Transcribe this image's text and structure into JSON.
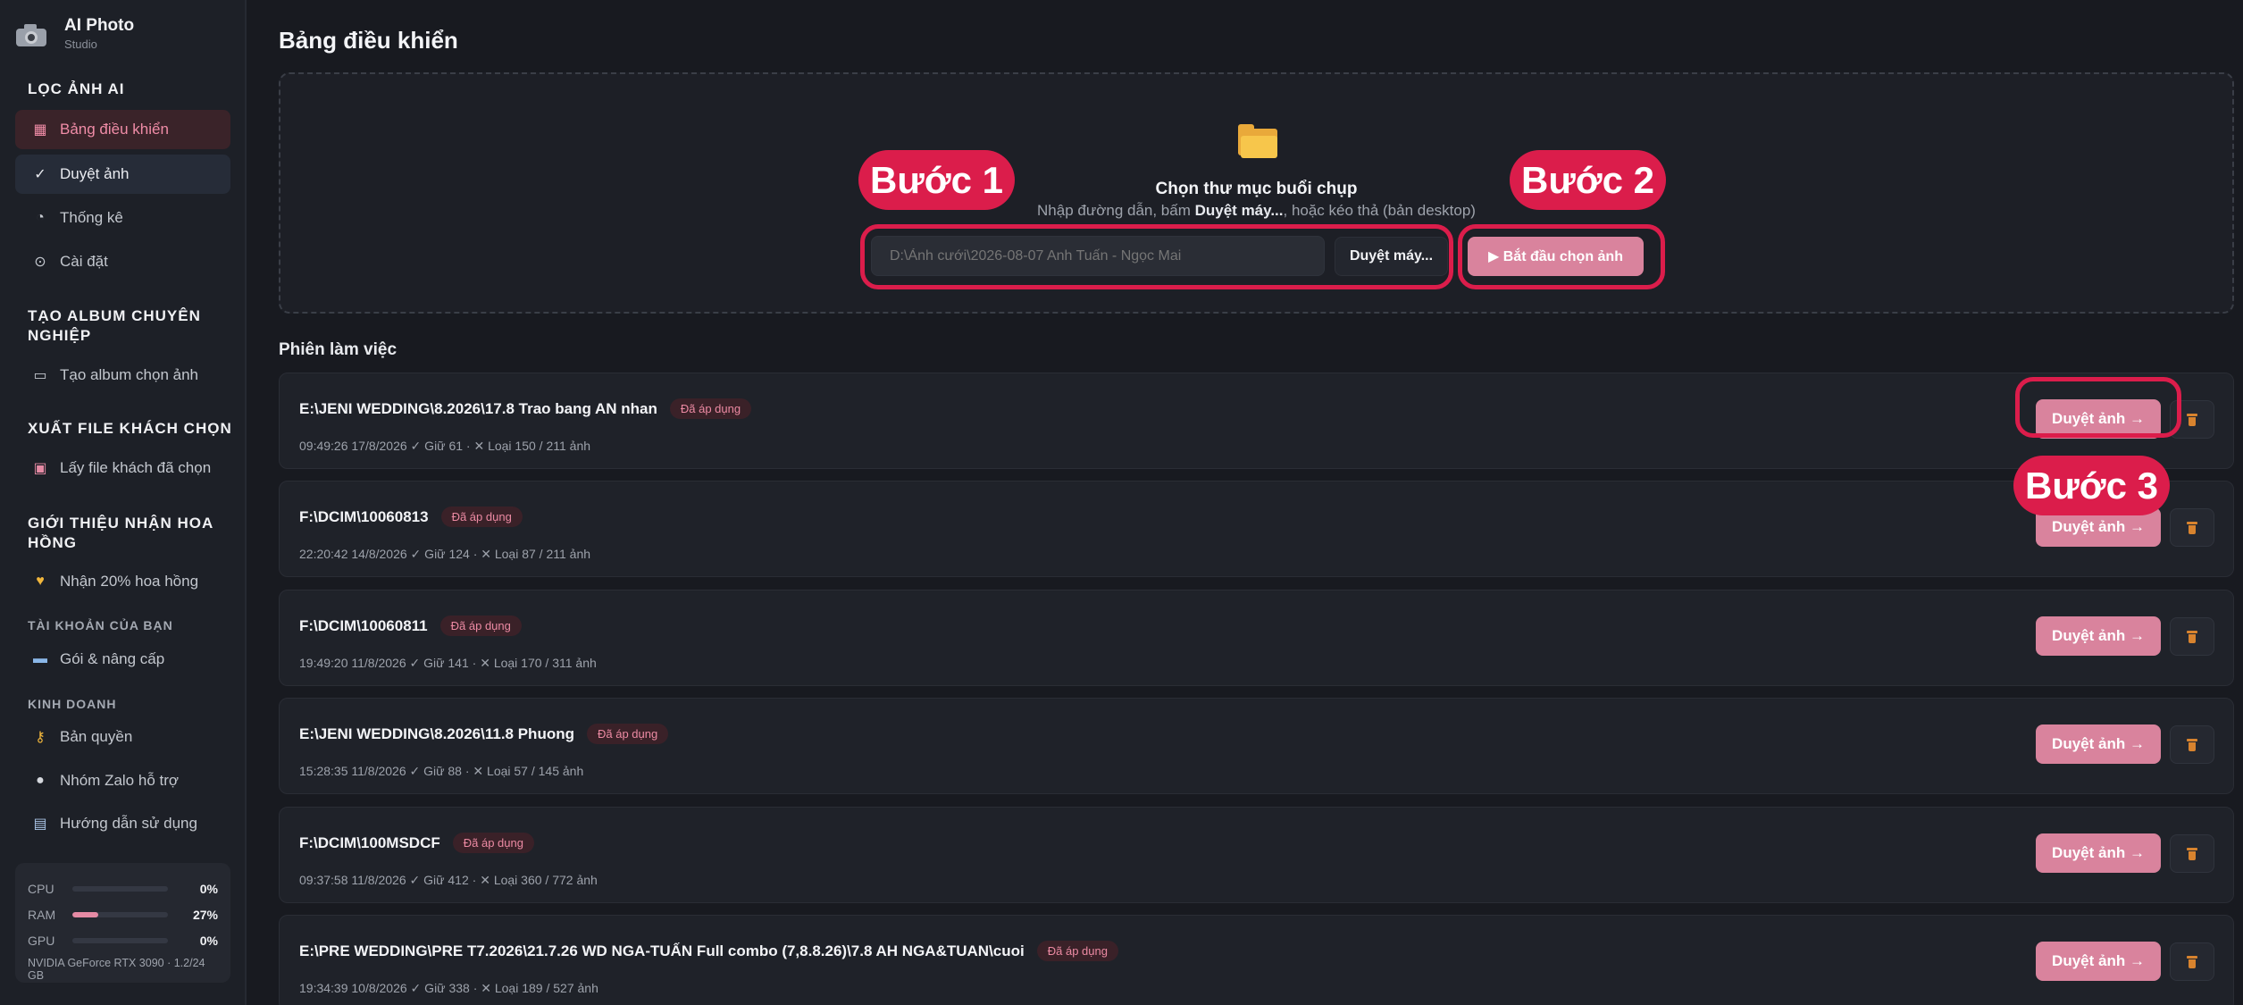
{
  "brand": {
    "title": "AI Photo",
    "subtitle": "Studio",
    "icon": "camera-icon"
  },
  "sidebar": {
    "section_filter": "LỌC ẢNH AI",
    "nav_dashboard": "Bảng điều khiển",
    "nav_review": "Duyệt ảnh",
    "nav_stats": "Thống kê",
    "nav_settings": "Cài đặt",
    "section_album": "TẠO ALBUM CHUYÊN NGHIỆP",
    "nav_album": "Tạo album chọn ảnh",
    "section_export": "XUẤT FILE KHÁCH CHỌN",
    "nav_export": "Lấy file khách đã chọn",
    "section_referral": "GIỚI THIỆU NHẬN HOA HỒNG",
    "nav_referral": "Nhận 20% hoa hồng",
    "section_account": "TÀI KHOẢN CỦA BẠN",
    "nav_plan": "Gói & nâng cấp",
    "section_business": "KINH DOANH",
    "nav_license": "Bản quyền",
    "nav_zalo": "Nhóm Zalo hỗ trợ",
    "nav_guide": "Hướng dẫn sử dụng"
  },
  "resources": {
    "cpu_label": "CPU",
    "cpu_value": "0%",
    "cpu_fraction": 0,
    "ram_label": "RAM",
    "ram_value": "27%",
    "ram_fraction": 0.27,
    "gpu_label": "GPU",
    "gpu_value": "0%",
    "gpu_fraction": 0,
    "gpu_name": "NVIDIA GeForce RTX 3090 · 1.2/24 GB"
  },
  "header": {
    "title": "Bảng điều khiển"
  },
  "dropzone": {
    "title": "Chọn thư mục buổi chụp",
    "desc_prefix": "Nhập đường dẫn, bấm ",
    "desc_bold": "Duyệt máy...",
    "desc_suffix": ", hoặc kéo thả (bản desktop)",
    "path_placeholder": "D:\\Ảnh cưới\\2026-08-07 Anh Tuấn - Ngọc Mai",
    "browse_label": "Duyệt máy...",
    "start_label": "▶ Bắt đầu chọn ảnh"
  },
  "steps": {
    "step1": "Bước 1",
    "step2": "Bước 2",
    "step3": "Bước 3"
  },
  "sessions": {
    "title": "Phiên làm việc",
    "review_label": "Duyệt ảnh →",
    "items": [
      {
        "path": "E:\\JENI WEDDING\\8.2026\\17.8 Trao bang AN nhan",
        "tag": "Đã áp dụng",
        "meta": "09:49:26 17/8/2026   ✓ Giữ 61 · ✕ Loại 150 / 211 ảnh"
      },
      {
        "path": "F:\\DCIM\\10060813",
        "tag": "Đã áp dụng",
        "meta": "22:20:42 14/8/2026   ✓ Giữ 124 · ✕ Loại 87 / 211 ảnh"
      },
      {
        "path": "F:\\DCIM\\10060811",
        "tag": "Đã áp dụng",
        "meta": "19:49:20 11/8/2026   ✓ Giữ 141 · ✕ Loại 170 / 311 ảnh"
      },
      {
        "path": "E:\\JENI WEDDING\\8.2026\\11.8 Phuong",
        "tag": "Đã áp dụng",
        "meta": "15:28:35 11/8/2026   ✓ Giữ 88 · ✕ Loại 57 / 145 ảnh"
      },
      {
        "path": "F:\\DCIM\\100MSDCF",
        "tag": "Đã áp dụng",
        "meta": "09:37:58 11/8/2026   ✓ Giữ 412 · ✕ Loại 360 / 772 ảnh"
      },
      {
        "path": "E:\\PRE WEDDING\\PRE T7.2026\\21.7.26 WD NGA-TUẤN Full combo (7,8.8.26)\\7.8 AH NGA&TUAN\\cuoi",
        "tag": "Đã áp dụng",
        "meta": "19:34:39 10/8/2026   ✓ Giữ 338 · ✕ Loại 189 / 527 ảnh"
      }
    ]
  },
  "colors": {
    "accent": "#d9839d",
    "highlight": "#db1d4b",
    "background": "#181a20"
  }
}
